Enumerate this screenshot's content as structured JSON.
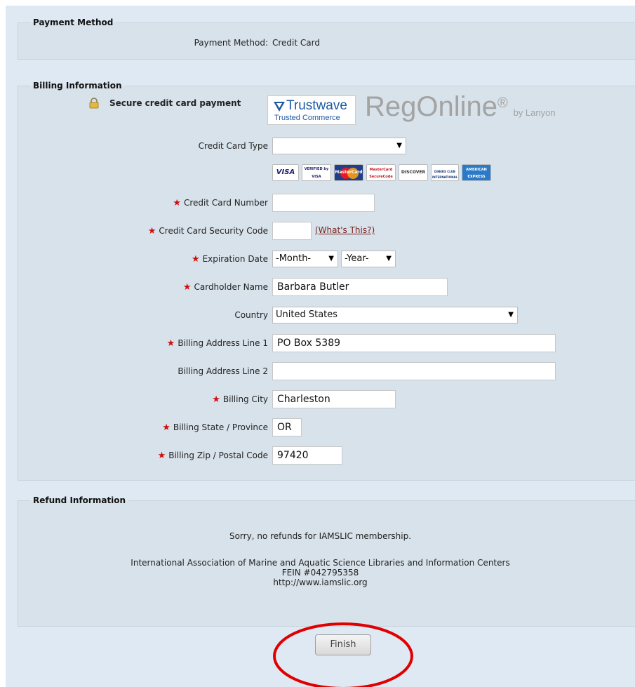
{
  "payment_method": {
    "legend": "Payment Method",
    "label": "Payment Method:",
    "value": "Credit Card"
  },
  "billing": {
    "legend": "Billing Information",
    "secure_text": "Secure credit card payment",
    "trustwave": {
      "name": "Trustwave",
      "tagline": "Trusted Commerce"
    },
    "regonline": {
      "name": "RegOnline",
      "reg_mark": "®",
      "by": "by Lanyon"
    },
    "card_type_label": "Credit Card Type",
    "card_type_value": "",
    "card_logos": [
      "VISA",
      "VERIFIED by VISA",
      "MasterCard",
      "MasterCard SecureCode",
      "DISCOVER",
      "DINERS CLUB INTERNATIONAL",
      "AMERICAN EXPRESS"
    ],
    "card_number_label": "Credit Card Number",
    "card_number_value": "",
    "security_code_label": "Credit Card Security Code",
    "security_code_value": "",
    "whats_this": "(What's This?)",
    "expiration_label": "Expiration Date",
    "month_value": "-Month-",
    "year_value": "-Year-",
    "cardholder_label": "Cardholder Name",
    "cardholder_value": "Barbara Butler",
    "country_label": "Country",
    "country_value": "United States",
    "address1_label": "Billing Address Line 1",
    "address1_value": "PO Box 5389",
    "address2_label": "Billing Address Line 2",
    "address2_value": "",
    "city_label": "Billing City",
    "city_value": "Charleston",
    "state_label": "Billing State / Province",
    "state_value": "OR",
    "zip_label": "Billing Zip / Postal Code",
    "zip_value": "97420",
    "required_mark": "★"
  },
  "refund": {
    "legend": "Refund Information",
    "notice": "Sorry, no refunds for IAMSLIC membership.",
    "org_name": "International Association of Marine and Aquatic Science Libraries and Information Centers",
    "fein": "FEIN #042795358",
    "url": "http://www.iamslic.org"
  },
  "finish_label": "Finish",
  "colors": {
    "background": "#dfe9f4",
    "section_bg": "#d8e2ea",
    "required": "#d10d0d",
    "highlight_circle": "#e00000"
  }
}
